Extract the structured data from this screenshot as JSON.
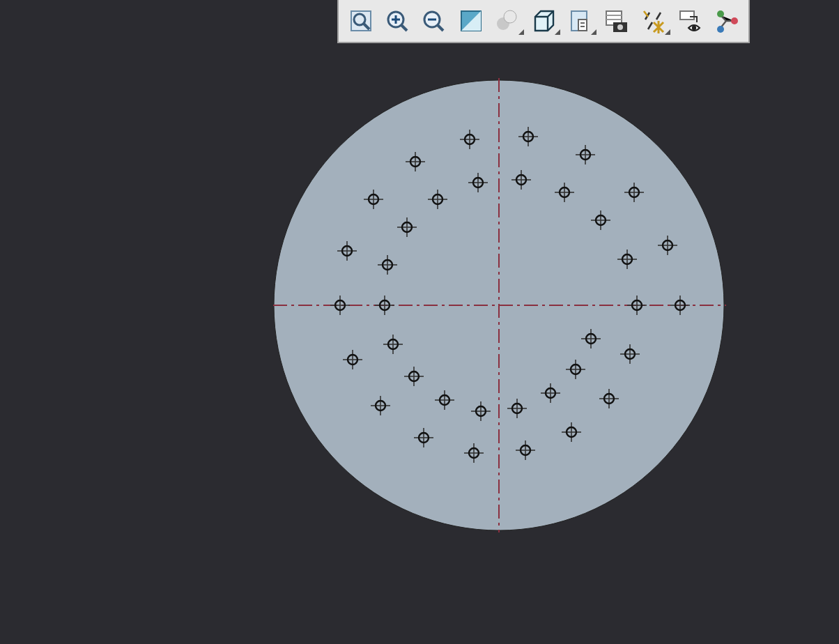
{
  "toolbar": {
    "buttons": [
      {
        "kind": "zoom-fit",
        "dropdown": false
      },
      {
        "kind": "zoom-in",
        "dropdown": false
      },
      {
        "kind": "zoom-out",
        "dropdown": false
      },
      {
        "kind": "zoom-area",
        "dropdown": false
      },
      {
        "kind": "shading",
        "dropdown": true
      },
      {
        "kind": "view-cube",
        "dropdown": true
      },
      {
        "kind": "document",
        "dropdown": true
      },
      {
        "kind": "snapshot",
        "dropdown": false
      },
      {
        "kind": "hidden-lines",
        "dropdown": true
      },
      {
        "kind": "visibility",
        "dropdown": false
      },
      {
        "kind": "tree",
        "dropdown": false
      }
    ]
  }
}
